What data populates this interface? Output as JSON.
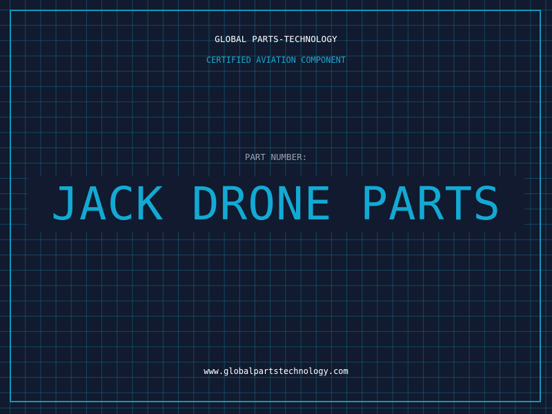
{
  "header": {
    "company": "GLOBAL PARTS-TECHNOLOGY",
    "subtitle": "CERTIFIED AVIATION COMPONENT"
  },
  "part": {
    "label": "PART NUMBER:",
    "name": "JACK DRONE PARTS"
  },
  "footer": {
    "url": "www.globalpartstechnology.com"
  },
  "colors": {
    "background": "#111a2e",
    "grid": "#146e8c",
    "accent": "#12aad4",
    "frame": "#1398ba",
    "text": "#ffffff",
    "muted": "#9aa4b6"
  }
}
